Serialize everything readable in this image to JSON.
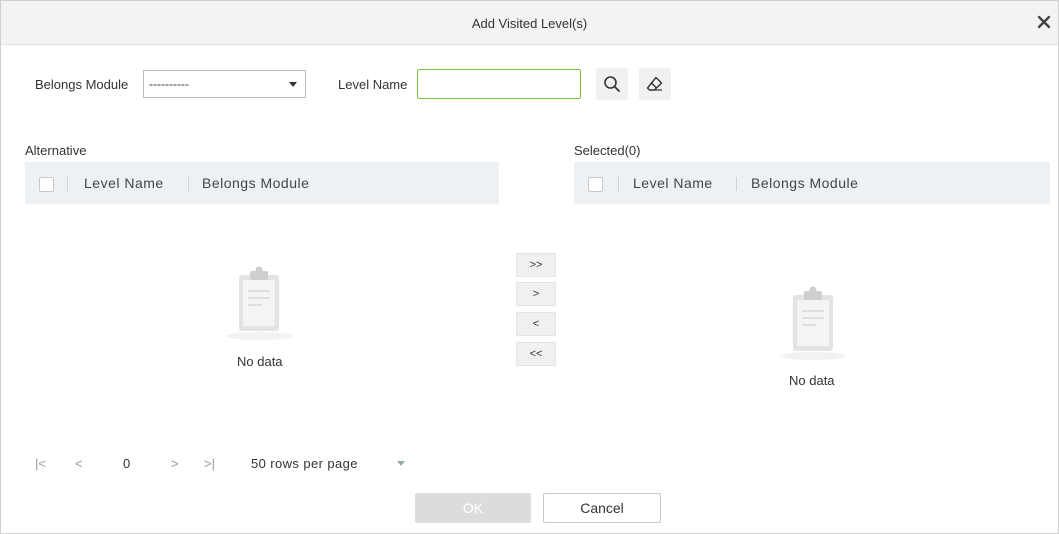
{
  "dialog": {
    "title": "Add Visited Level(s)"
  },
  "filters": {
    "belongs_module_label": "Belongs Module",
    "belongs_module_value": "----------",
    "level_name_label": "Level Name",
    "level_name_value": ""
  },
  "alternative": {
    "label": "Alternative",
    "columns": [
      "Level Name",
      "Belongs Module"
    ],
    "empty_text": "No data"
  },
  "selected": {
    "label": "Selected(0)",
    "columns": [
      "Level Name",
      "Belongs Module"
    ],
    "empty_text": "No data"
  },
  "transfer_buttons": [
    ">>",
    ">",
    "<",
    "<<"
  ],
  "pagination": {
    "first": "|<",
    "prev": "<",
    "page": "0",
    "next": ">",
    "last": ">|",
    "page_size": "50 rows per page"
  },
  "footer": {
    "ok_label": "OK",
    "cancel_label": "Cancel"
  },
  "colors": {
    "input_focus_border": "#7ac143",
    "header_bg": "#eef1f4",
    "ok_disabled": "#dcdcdc"
  },
  "icons": [
    "close-icon",
    "search-icon",
    "eraser-icon",
    "clipboard-icon",
    "chevron-down-icon"
  ]
}
